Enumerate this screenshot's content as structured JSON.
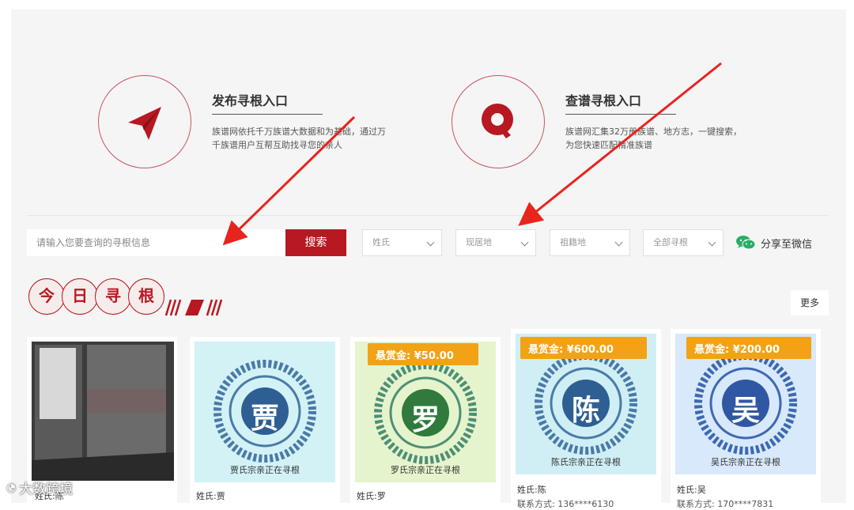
{
  "entries": [
    {
      "title": "发布寻根入口",
      "desc_line1": "族谱网依托千万族谱大数据和为基础，通过万",
      "desc_line2": "千族谱用户互帮互助找寻您的亲人",
      "icon": "paper-plane-icon"
    },
    {
      "title": "查谱寻根入口",
      "desc_line1": "族谱网汇集32万册族谱、地方志，一键搜索，",
      "desc_line2": "为您快速匹配精准族谱",
      "icon": "search-icon"
    }
  ],
  "search": {
    "placeholder": "请输入您要查询的寻根信息",
    "button_label": "搜索"
  },
  "filters": [
    "姓氏",
    "现居地",
    "祖籍地",
    "全部寻根"
  ],
  "share_label": "分享至微信",
  "section": {
    "title_chars": [
      "今",
      "日",
      "寻",
      "根"
    ],
    "more_label": "更多"
  },
  "cards": [
    {
      "surname_label": "姓氏:陈",
      "caption": "",
      "seal_char": "",
      "reward": "",
      "phone": ""
    },
    {
      "surname_label": "姓氏:贾",
      "caption": "贾氏宗亲正在寻根",
      "seal_char": "贾",
      "reward": "",
      "phone": ""
    },
    {
      "surname_label": "姓氏:罗",
      "caption": "罗氏宗亲正在寻根",
      "seal_char": "罗",
      "reward": "悬赏金: ¥50.00",
      "phone": ""
    },
    {
      "surname_label": "姓氏:陈",
      "caption": "陈氏宗亲正在寻根",
      "seal_char": "陈",
      "reward": "悬赏金: ¥600.00",
      "phone": "联系方式: 136****6130"
    },
    {
      "surname_label": "姓氏:吴",
      "caption": "吴氏宗亲正在寻根",
      "seal_char": "吴",
      "reward": "悬赏金: ¥200.00",
      "phone": "联系方式: 170****7831"
    }
  ],
  "watermark": "大数跨境",
  "colors": {
    "brand_red": "#b71822",
    "reward_orange": "#f3a215",
    "arrow_red": "#e8241f",
    "wechat_green": "#2aae67"
  }
}
